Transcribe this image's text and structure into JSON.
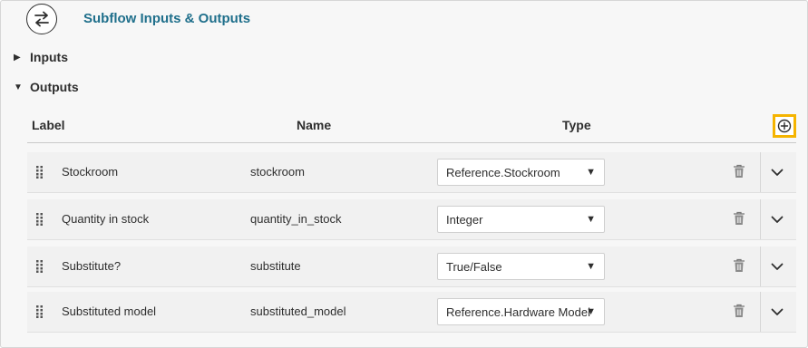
{
  "header": {
    "title": "Subflow Inputs & Outputs",
    "icon": "swap-arrows-icon"
  },
  "sections": {
    "inputs_label": "Inputs",
    "outputs_label": "Outputs"
  },
  "table": {
    "columns": {
      "label": "Label",
      "name": "Name",
      "type": "Type"
    },
    "add_icon": "plus-circle-icon",
    "rows": [
      {
        "label": "Stockroom",
        "name": "stockroom",
        "type": "Reference.Stockroom"
      },
      {
        "label": "Quantity in stock",
        "name": "quantity_in_stock",
        "type": "Integer"
      },
      {
        "label": "Substitute?",
        "name": "substitute",
        "type": "True/False"
      },
      {
        "label": "Substituted model",
        "name": "substituted_model",
        "type": "Reference.Hardware Model"
      }
    ]
  },
  "colors": {
    "title": "#1f6f8b",
    "focus_outline": "#f5b400"
  }
}
